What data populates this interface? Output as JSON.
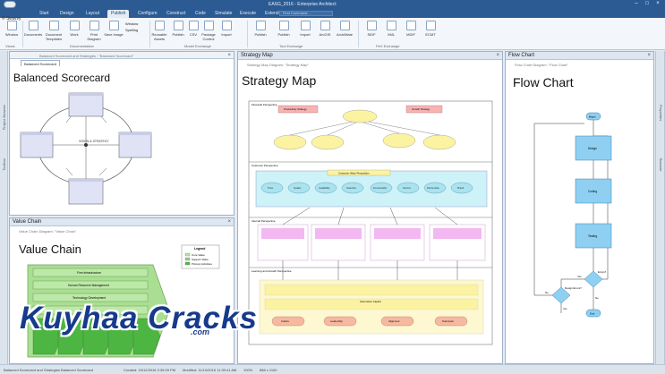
{
  "titlebar": {
    "title": "EASG_2016 - Enterprise Architect"
  },
  "menu": {
    "tabs": [
      "Start",
      "Design",
      "Layout",
      "Publish",
      "Configure",
      "Construct",
      "Code",
      "Simulate",
      "Execute",
      "Extend"
    ],
    "active_index": 3,
    "search_placeholder": "Find Command..."
  },
  "ribbon": {
    "subnote": "© Seavvy",
    "buttons": [
      "Window",
      "Documents",
      "Document Templates",
      "Work",
      "Print Diagram",
      "Save Image",
      "Reusable Assets",
      "Publish",
      "CSV",
      "Package Control",
      "Import",
      "Publish",
      "Publish",
      "Import",
      "ArcGIS",
      "ArchiMate",
      "SIDF",
      "XML",
      "MDIF",
      "ECMT"
    ],
    "small_buttons": [
      "Window",
      "Spelling"
    ],
    "groups": [
      "Views",
      "Documentation",
      "Model Exchange",
      "Tool Exchange",
      "PeX Exchange"
    ]
  },
  "side": {
    "left_tabs": [
      "Project Browser",
      "Toolbox"
    ],
    "right_tabs": [
      "Properties",
      "Browser"
    ]
  },
  "panes": {
    "balanced": {
      "crumb": "Balanced Scorecard and Strategies : \"Balanced Scorecard\"",
      "tab": "Balanced Scorecard",
      "title": "Balanced Scorecard",
      "center_label": "VISION & STRATEGY"
    },
    "value": {
      "header": "Value Chain",
      "crumb": "Value Chain Diagram: \"Value Chain\"",
      "title": "Value Chain",
      "legend": {
        "title": "Legend",
        "items": [
          "Core Value",
          "Support Value",
          "Primary Activities"
        ]
      },
      "rows": [
        "Firm Infrastructure",
        "Human Resource Management",
        "Technology Development",
        "Procurement"
      ]
    },
    "strategy": {
      "header": "Strategy Map",
      "crumb": "Strategy Map Diagram: \"Strategy Map\"",
      "title": "Strategy Map",
      "lanes": [
        "Financial Perspective",
        "Customer Perspective",
        "Internal Perspective",
        "Learning and Growth Perspective"
      ],
      "top_boxes": [
        "Productivity Strategy",
        "Growth Strategy"
      ],
      "value_prop": "Customer Value Proposition",
      "value_items": [
        "Price",
        "Quality",
        "Availability",
        "Selection",
        "Functionality",
        "Service",
        "Partnership",
        "Brand"
      ],
      "info_capital": "Information Capital",
      "people": [
        "Culture",
        "Leadership",
        "Alignment",
        "Teamwork"
      ]
    },
    "flow": {
      "header": "Flow Chart",
      "crumb": "Flow Chart Diagram: \"Flow Chart\"",
      "title": "Flow Chart",
      "nodes": [
        "Begin",
        "Design",
        "Coding",
        "Testing",
        "Design Errors?",
        "Errors?",
        "End"
      ],
      "edges": [
        "Yes",
        "No",
        "Yes",
        "No"
      ]
    }
  },
  "status": {
    "left": "Balanced Scorecard and Strategies Balanced Scorecard",
    "created": "Created: 19/12/2016 2:39:09 PM",
    "modified": "Modified: 11/10/2016 11:39:41 AM",
    "zoom": "100%",
    "size": "886 x 1100"
  },
  "watermark": {
    "main": "Kuyhaa Cracks",
    "sub": ".com"
  }
}
